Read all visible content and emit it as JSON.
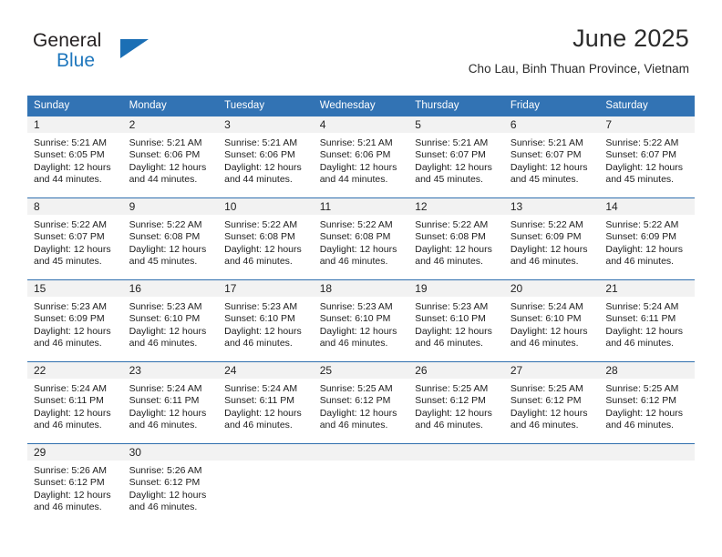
{
  "brand": {
    "name_top": "General",
    "name_bottom": "Blue",
    "accent_color": "#1f77bd",
    "triangle_icon": "triangle-icon"
  },
  "header": {
    "title": "June 2025",
    "subtitle": "Cho Lau, Binh Thuan Province, Vietnam"
  },
  "calendar": {
    "header_bg": "#3273b4",
    "daynum_bg": "#f2f2f2",
    "weekday_headers": [
      "Sunday",
      "Monday",
      "Tuesday",
      "Wednesday",
      "Thursday",
      "Friday",
      "Saturday"
    ],
    "weeks": [
      [
        {
          "day": "1",
          "sunrise": "Sunrise: 5:21 AM",
          "sunset": "Sunset: 6:05 PM",
          "daylight": "Daylight: 12 hours and 44 minutes."
        },
        {
          "day": "2",
          "sunrise": "Sunrise: 5:21 AM",
          "sunset": "Sunset: 6:06 PM",
          "daylight": "Daylight: 12 hours and 44 minutes."
        },
        {
          "day": "3",
          "sunrise": "Sunrise: 5:21 AM",
          "sunset": "Sunset: 6:06 PM",
          "daylight": "Daylight: 12 hours and 44 minutes."
        },
        {
          "day": "4",
          "sunrise": "Sunrise: 5:21 AM",
          "sunset": "Sunset: 6:06 PM",
          "daylight": "Daylight: 12 hours and 44 minutes."
        },
        {
          "day": "5",
          "sunrise": "Sunrise: 5:21 AM",
          "sunset": "Sunset: 6:07 PM",
          "daylight": "Daylight: 12 hours and 45 minutes."
        },
        {
          "day": "6",
          "sunrise": "Sunrise: 5:21 AM",
          "sunset": "Sunset: 6:07 PM",
          "daylight": "Daylight: 12 hours and 45 minutes."
        },
        {
          "day": "7",
          "sunrise": "Sunrise: 5:22 AM",
          "sunset": "Sunset: 6:07 PM",
          "daylight": "Daylight: 12 hours and 45 minutes."
        }
      ],
      [
        {
          "day": "8",
          "sunrise": "Sunrise: 5:22 AM",
          "sunset": "Sunset: 6:07 PM",
          "daylight": "Daylight: 12 hours and 45 minutes."
        },
        {
          "day": "9",
          "sunrise": "Sunrise: 5:22 AM",
          "sunset": "Sunset: 6:08 PM",
          "daylight": "Daylight: 12 hours and 45 minutes."
        },
        {
          "day": "10",
          "sunrise": "Sunrise: 5:22 AM",
          "sunset": "Sunset: 6:08 PM",
          "daylight": "Daylight: 12 hours and 46 minutes."
        },
        {
          "day": "11",
          "sunrise": "Sunrise: 5:22 AM",
          "sunset": "Sunset: 6:08 PM",
          "daylight": "Daylight: 12 hours and 46 minutes."
        },
        {
          "day": "12",
          "sunrise": "Sunrise: 5:22 AM",
          "sunset": "Sunset: 6:08 PM",
          "daylight": "Daylight: 12 hours and 46 minutes."
        },
        {
          "day": "13",
          "sunrise": "Sunrise: 5:22 AM",
          "sunset": "Sunset: 6:09 PM",
          "daylight": "Daylight: 12 hours and 46 minutes."
        },
        {
          "day": "14",
          "sunrise": "Sunrise: 5:22 AM",
          "sunset": "Sunset: 6:09 PM",
          "daylight": "Daylight: 12 hours and 46 minutes."
        }
      ],
      [
        {
          "day": "15",
          "sunrise": "Sunrise: 5:23 AM",
          "sunset": "Sunset: 6:09 PM",
          "daylight": "Daylight: 12 hours and 46 minutes."
        },
        {
          "day": "16",
          "sunrise": "Sunrise: 5:23 AM",
          "sunset": "Sunset: 6:10 PM",
          "daylight": "Daylight: 12 hours and 46 minutes."
        },
        {
          "day": "17",
          "sunrise": "Sunrise: 5:23 AM",
          "sunset": "Sunset: 6:10 PM",
          "daylight": "Daylight: 12 hours and 46 minutes."
        },
        {
          "day": "18",
          "sunrise": "Sunrise: 5:23 AM",
          "sunset": "Sunset: 6:10 PM",
          "daylight": "Daylight: 12 hours and 46 minutes."
        },
        {
          "day": "19",
          "sunrise": "Sunrise: 5:23 AM",
          "sunset": "Sunset: 6:10 PM",
          "daylight": "Daylight: 12 hours and 46 minutes."
        },
        {
          "day": "20",
          "sunrise": "Sunrise: 5:24 AM",
          "sunset": "Sunset: 6:10 PM",
          "daylight": "Daylight: 12 hours and 46 minutes."
        },
        {
          "day": "21",
          "sunrise": "Sunrise: 5:24 AM",
          "sunset": "Sunset: 6:11 PM",
          "daylight": "Daylight: 12 hours and 46 minutes."
        }
      ],
      [
        {
          "day": "22",
          "sunrise": "Sunrise: 5:24 AM",
          "sunset": "Sunset: 6:11 PM",
          "daylight": "Daylight: 12 hours and 46 minutes."
        },
        {
          "day": "23",
          "sunrise": "Sunrise: 5:24 AM",
          "sunset": "Sunset: 6:11 PM",
          "daylight": "Daylight: 12 hours and 46 minutes."
        },
        {
          "day": "24",
          "sunrise": "Sunrise: 5:24 AM",
          "sunset": "Sunset: 6:11 PM",
          "daylight": "Daylight: 12 hours and 46 minutes."
        },
        {
          "day": "25",
          "sunrise": "Sunrise: 5:25 AM",
          "sunset": "Sunset: 6:12 PM",
          "daylight": "Daylight: 12 hours and 46 minutes."
        },
        {
          "day": "26",
          "sunrise": "Sunrise: 5:25 AM",
          "sunset": "Sunset: 6:12 PM",
          "daylight": "Daylight: 12 hours and 46 minutes."
        },
        {
          "day": "27",
          "sunrise": "Sunrise: 5:25 AM",
          "sunset": "Sunset: 6:12 PM",
          "daylight": "Daylight: 12 hours and 46 minutes."
        },
        {
          "day": "28",
          "sunrise": "Sunrise: 5:25 AM",
          "sunset": "Sunset: 6:12 PM",
          "daylight": "Daylight: 12 hours and 46 minutes."
        }
      ],
      [
        {
          "day": "29",
          "sunrise": "Sunrise: 5:26 AM",
          "sunset": "Sunset: 6:12 PM",
          "daylight": "Daylight: 12 hours and 46 minutes."
        },
        {
          "day": "30",
          "sunrise": "Sunrise: 5:26 AM",
          "sunset": "Sunset: 6:12 PM",
          "daylight": "Daylight: 12 hours and 46 minutes."
        },
        {
          "day": "",
          "sunrise": "",
          "sunset": "",
          "daylight": ""
        },
        {
          "day": "",
          "sunrise": "",
          "sunset": "",
          "daylight": ""
        },
        {
          "day": "",
          "sunrise": "",
          "sunset": "",
          "daylight": ""
        },
        {
          "day": "",
          "sunrise": "",
          "sunset": "",
          "daylight": ""
        },
        {
          "day": "",
          "sunrise": "",
          "sunset": "",
          "daylight": ""
        }
      ]
    ]
  }
}
